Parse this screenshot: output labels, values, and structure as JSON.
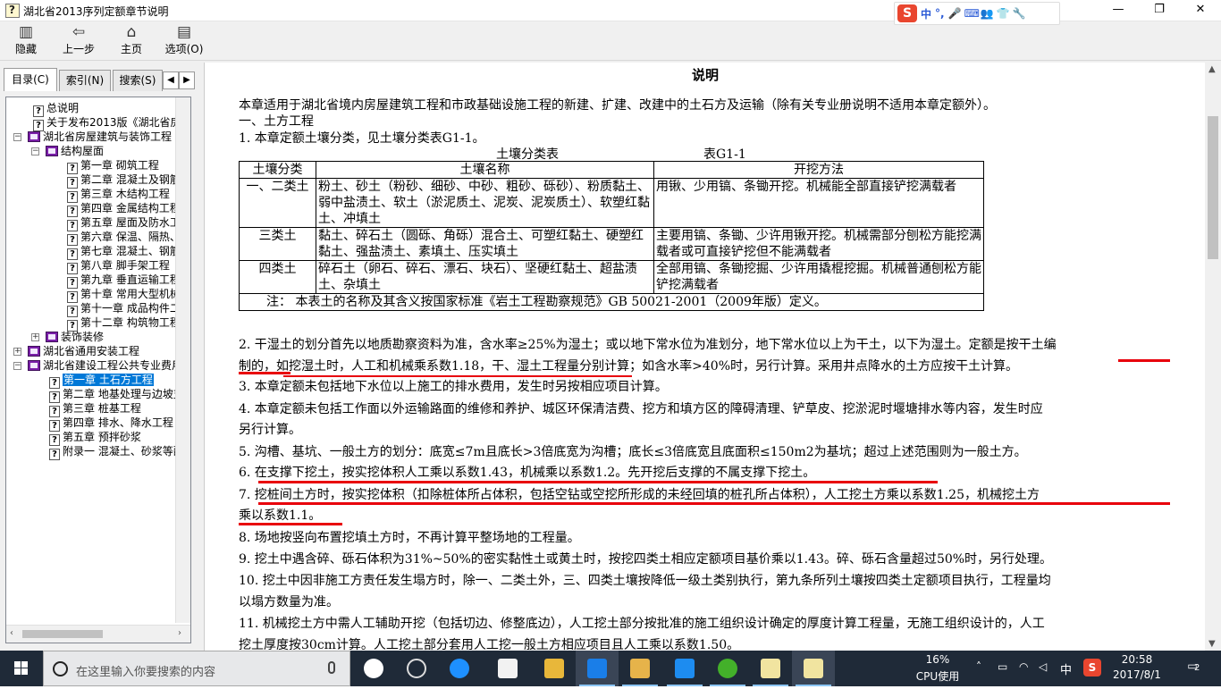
{
  "window": {
    "title": "湖北省2013序列定额章节说明",
    "min_label": "—",
    "max_label": "❐",
    "close_label": "✕"
  },
  "ime": {
    "logo": "S",
    "mode": "中",
    "punct": "°,"
  },
  "toolbar": {
    "hide": "隐藏",
    "back": "上一步",
    "home": "主页",
    "options": "选项(O)"
  },
  "tabs": {
    "contents": "目录(C)",
    "index": "索引(N)",
    "search": "搜索(S)"
  },
  "tree": [
    {
      "label": "总说明"
    },
    {
      "label": "关于发布2013版《湖北省房屋"
    },
    {
      "label": "湖北省房屋建筑与装饰工程"
    },
    {
      "label": "结构屋面"
    },
    {
      "label": "第一章  砌筑工程"
    },
    {
      "label": "第二章  混凝土及钢筋:"
    },
    {
      "label": "第三章  木结构工程"
    },
    {
      "label": "第四章  金属结构工程"
    },
    {
      "label": "第五章  屋面及防水工程"
    },
    {
      "label": "第六章  保温、隔热、防"
    },
    {
      "label": "第七章  混凝土、钢筋:"
    },
    {
      "label": "第八章  脚手架工程"
    },
    {
      "label": "第九章  垂直运输工程"
    },
    {
      "label": "第十章  常用大型机械"
    },
    {
      "label": "第十一章  成品构件二次"
    },
    {
      "label": "第十二章  构筑物工程"
    },
    {
      "label": "装饰装修"
    },
    {
      "label": "湖北省通用安装工程"
    },
    {
      "label": "湖北省建设工程公共专业费用"
    },
    {
      "label": "第一章  土石方工程"
    },
    {
      "label": "第二章  地基处理与边坡支"
    },
    {
      "label": "第三章  桩基工程"
    },
    {
      "label": "第四章  排水、降水工程"
    },
    {
      "label": "第五章  预拌砂浆"
    },
    {
      "label": "附录一  混凝土、砂浆等配"
    }
  ],
  "doc": {
    "heading": "说明",
    "intro": "本章适用于湖北省境内房屋建筑工程和市政基础设施工程的新建、扩建、改建中的土石方及运输（除有关专业册说明不适用本章定额外）。",
    "section1": "一、土方工程",
    "item1": "1. 本章定额土壤分类，见土壤分类表G1-1。",
    "table_caption": "土壤分类表",
    "table_no": "表G1-1",
    "table_headers": [
      "土壤分类",
      "土壤名称",
      "开挖方法"
    ],
    "table_rows": [
      {
        "cls": "一、二类土",
        "name": "粉土、砂土（粉砂、细砂、中砂、粗砂、砾砂）、粉质黏土、弱中盐渍土、软土（淤泥质土、泥炭、泥炭质土）、软塑红黏土、冲填土",
        "method": "用锹、少用镐、条锄开挖。机械能全部直接铲挖满载者"
      },
      {
        "cls": "三类土",
        "name": "黏土、碎石土（圆砾、角砾）混合土、可塑红黏土、硬塑红黏土、强盐渍土、素填土、压实填土",
        "method": "主要用镐、条锄、少许用锹开挖。机械需部分刨松方能挖满载者或可直接铲挖但不能满载者"
      },
      {
        "cls": "四类土",
        "name": "碎石土（卵石、碎石、漂石、块石）、坚硬红黏土、超盐渍土、杂填土",
        "method": "全部用镐、条锄挖掘、少许用撬棍挖掘。机械普通刨松方能铲挖满载者"
      }
    ],
    "table_note": "注：  本表土的名称及其含义按国家标准《岩土工程勘察规范》GB 50021-2001（2009年版）定义。",
    "item2a": "2. 干湿土的划分首先以地质勘察资料为准，含水率≥25%为湿土；或以地下常水位为准划分，地下常水位以上为干土，以下为湿土。定额是按干土编",
    "item2b": "制的，如挖湿土时，人工和机械乘系数1.18，干、湿土工程量分别计算；如含水率>40%时，另行计算。采用井点降水的土方应按干土计算。",
    "item3": "3. 本章定额未包括地下水位以上施工的排水费用，发生时另按相应项目计算。",
    "item4a": "4. 本章定额未包括工作面以外运输路面的维修和养护、城区环保清洁费、挖方和填方区的障碍清理、铲草皮、挖淤泥时堰塘排水等内容，发生时应",
    "item4b": "另行计算。",
    "item5": "5. 沟槽、基坑、一般土方的划分：底宽≤7m且底长>3倍底宽为沟槽；底长≤3倍底宽且底面积≤150m2为基坑；超过上述范围则为一般土方。",
    "item6": "6. 在支撑下挖土，按实挖体积人工乘以系数1.43，机械乘以系数1.2。先开挖后支撑的不属支撑下挖土。",
    "item7a": "7. 挖桩间土方时，按实挖体积（扣除桩体所占体积，包括空钻或空挖所形成的未经回填的桩孔所占体积），人工挖土方乘以系数1.25，机械挖土方",
    "item7b": "乘以系数1.1。",
    "item8": "8. 场地按竖向布置挖填土方时，不再计算平整场地的工程量。",
    "item9": "9. 挖土中遇含碎、砾石体积为31%~50%的密实黏性土或黄土时，按挖四类土相应定额项目基价乘以1.43。碎、砾石含量超过50%时，另行处理。",
    "item10a": "10. 挖土中因非施工方责任发生塌方时，除一、二类土外，三、四类土壤按降低一级土类别执行，第九条所列土壤按四类土定额项目执行，工程量均",
    "item10b": "以塌方数量为准。",
    "item11a": "11. 机械挖土方中需人工辅助开挖（包括切边、修整底边），人工挖土部分按批准的施工组织设计确定的厚度计算工程量，无施工组织设计的，人工",
    "item11b": "挖土厚度按30cm计算。人工挖土部分套用人工挖一般土方相应项目且人工乘以系数1.50。"
  },
  "taskbar": {
    "search_placeholder": "在这里输入你要搜索的内容",
    "cpu_pct": "16%",
    "cpu_label": "CPU使用",
    "ime_lang": "中",
    "time": "20:58",
    "date": "2017/8/1",
    "notif_count": "2"
  },
  "colors": {
    "underline": "#e8000b",
    "selection": "#0078d7",
    "taskbar": "#1f2a38"
  }
}
